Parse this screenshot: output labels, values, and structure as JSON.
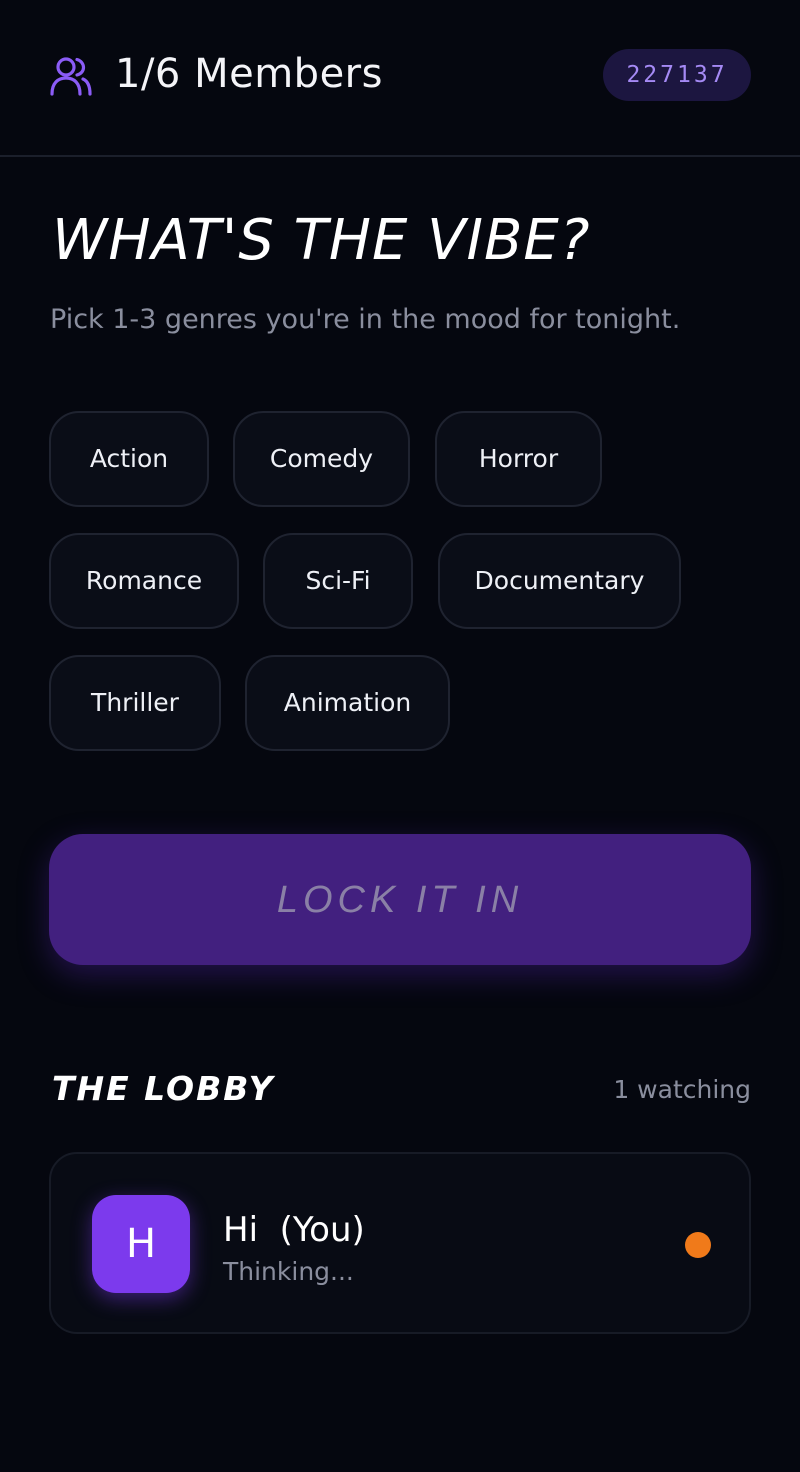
{
  "header": {
    "members_icon": "users-icon",
    "members_label": "1/6 Members",
    "room_code": "227137"
  },
  "main": {
    "title": "WHAT'S THE VIBE?",
    "subtitle": "Pick 1-3 genres you're in the mood for tonight.",
    "genres": [
      "Action",
      "Comedy",
      "Horror",
      "Romance",
      "Sci-Fi",
      "Documentary",
      "Thriller",
      "Animation"
    ],
    "lock_button_label": "LOCK IT IN"
  },
  "lobby": {
    "title": "THE LOBBY",
    "count": "1 watching",
    "members": [
      {
        "initial": "H",
        "name": "Hi  (You)",
        "status": "Thinking..."
      }
    ]
  },
  "colors": {
    "background": "#05070f",
    "accent": "#7c3aed",
    "button": "#42207f",
    "room_code_text": "#a58af5",
    "status_thinking": "#f07a1a"
  }
}
